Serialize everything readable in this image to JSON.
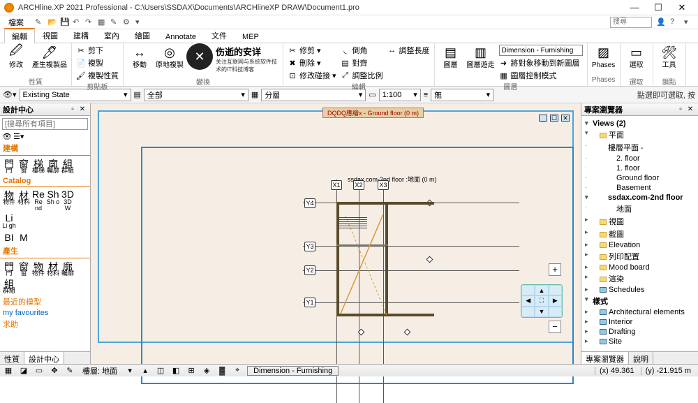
{
  "title": "ARCHline.XP 2021  Professional - C:\\Users\\SSDAX\\Documents\\ARCHlineXP DRAW\\Document1.pro",
  "menu": {
    "file": "檔案",
    "edit": "編輯",
    "view": "視圖",
    "build": "建構",
    "interior": "室內",
    "draw": "繪圖",
    "annotate": "Annotate",
    "doc": "文件",
    "mep": "MEP"
  },
  "search_placeholder": "搜尋",
  "ribbon": {
    "g1": {
      "label": "性質",
      "btn1": "修改",
      "btn2": "產生複製品"
    },
    "g2": {
      "label": "剪貼板",
      "m1": "剪下",
      "m2": "複製",
      "m3": "複製性質"
    },
    "g3": {
      "label": "變換",
      "btn1": "移動",
      "btn2": "原地複製",
      "m1": "修剪",
      "m2": "刪除",
      "m3": "修改碰接",
      "m4": "倒角",
      "m5": "對齊",
      "m6": "調整比例",
      "m7": "調整長度"
    },
    "watermark": {
      "line1": "伤逝的安详",
      "line2": "关注互联网与系统软件技术的IT科技博客"
    },
    "g4": {
      "label": "編輯"
    },
    "g5": {
      "label": "圖層",
      "btn1": "圖層",
      "btn2": "圖層遊走",
      "combo": "Dimension - Furnishing",
      "m1": "將對象移動到新圖層",
      "m2": "圖層控制模式"
    },
    "g6": {
      "label": "Phases",
      "btn": "Phases"
    },
    "g7": {
      "label": "選取",
      "btn": "選取"
    },
    "g8": {
      "label": "鎖點",
      "btn": "工具"
    }
  },
  "opt": {
    "state": "Existing State",
    "all": "全部",
    "layer": "分層",
    "scale": "1:100",
    "none": "無",
    "hint": "點選即可選取, 按"
  },
  "dc": {
    "title": "設計中心",
    "search_ph": "[搜尋所有項目]",
    "sec1": "建構",
    "row1": [
      [
        "門",
        "門"
      ],
      [
        "窗",
        "窗"
      ],
      [
        "梯",
        "樓梯"
      ],
      [
        "廓",
        "輪廓"
      ],
      [
        "組",
        "群組"
      ]
    ],
    "sec2": "Catalog",
    "row2": [
      [
        "物",
        "物件"
      ],
      [
        "材",
        "材料"
      ],
      [
        "Re",
        "Re nd"
      ],
      [
        "Sh",
        "Sh o"
      ],
      [
        "3D",
        "3D W"
      ],
      [
        "Li",
        "Li gh"
      ]
    ],
    "row2b": [
      [
        "BI",
        ""
      ],
      [
        "M",
        ""
      ]
    ],
    "sec3": "產生",
    "row3": [
      [
        "門",
        "門"
      ],
      [
        "窗",
        "窗"
      ],
      [
        "物",
        "物件"
      ],
      [
        "材",
        "材料"
      ],
      [
        "廓",
        "輪廓"
      ],
      [
        "組",
        "群組"
      ]
    ],
    "link1": "最近的模型",
    "link2": "my favourites",
    "link3": "求助",
    "tab1": "性質",
    "tab2": "設計中心"
  },
  "pb": {
    "title": "專案瀏覽器",
    "views": "Views (2)",
    "plan": "平面",
    "floorplan": "樓層平面 -",
    "f2": "2. floor",
    "f1": "1. floor",
    "gf": "Ground floor",
    "bs": "Basement",
    "sel": "ssdax.com-2nd floor",
    "ground": "地面",
    "view": "視圖",
    "section": "截圖",
    "elev": "Elevation",
    "print": "列印配置",
    "mood": "Mood board",
    "render": "渲染",
    "sched": "Schedules",
    "style": "樣式",
    "arch": "Architectural elements",
    "interior": "Interior",
    "draft": "Drafting",
    "site": "Site",
    "tab1": "專案瀏覽器",
    "tab2": "說明"
  },
  "canvas": {
    "top": "DQDQ應繪x  -  Ground floor (0 m)",
    "floor": "ssdax.com-2nd floor :地面 (0 m)",
    "x1": "X1",
    "x2": "X2",
    "x3": "X3",
    "y1": "Y1",
    "y2": "Y2",
    "y3": "Y3",
    "y4": "Y4"
  },
  "status": {
    "layer": "樓層: 地面",
    "dim": "Dimension - Furnishing",
    "x": "(x) 49.361",
    "y": "(y) -21.915 m"
  }
}
